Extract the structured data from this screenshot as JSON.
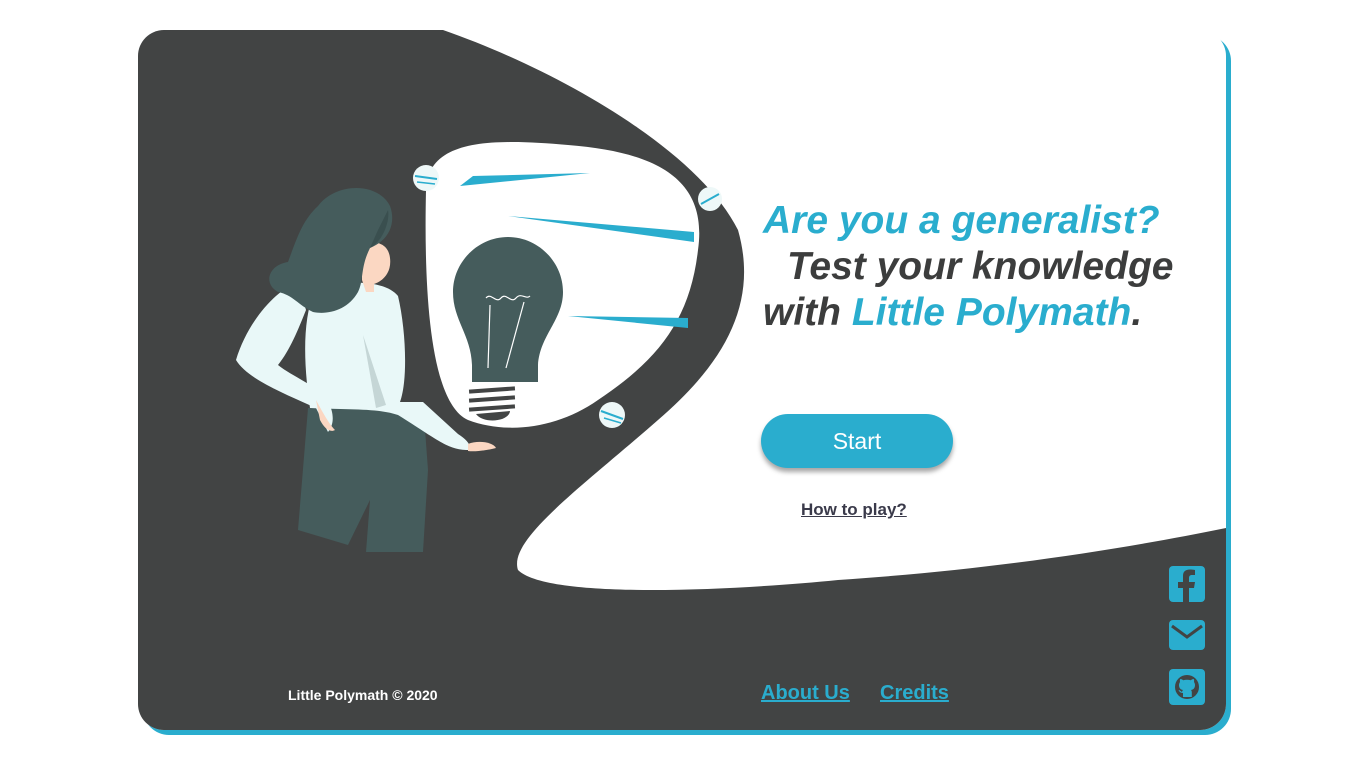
{
  "theme": {
    "accent": "#2aadce",
    "dark": "#424444",
    "figure": "#455c5c"
  },
  "hero": {
    "line1": "Are you a generalist?",
    "line2": "Test your knowledge",
    "line3_prefix": "with ",
    "line3_brand": "Little Polymath",
    "line3_suffix": "."
  },
  "actions": {
    "start_label": "Start",
    "how_to_label": "How to play?"
  },
  "footer": {
    "copyright": "Little Polymath © 2020",
    "links": [
      "About Us",
      "Credits"
    ]
  },
  "social": {
    "icons": [
      "facebook-icon",
      "mail-icon",
      "github-icon"
    ]
  },
  "illustration": {
    "icons": [
      "woman-figure-icon",
      "lightbulb-icon"
    ]
  }
}
